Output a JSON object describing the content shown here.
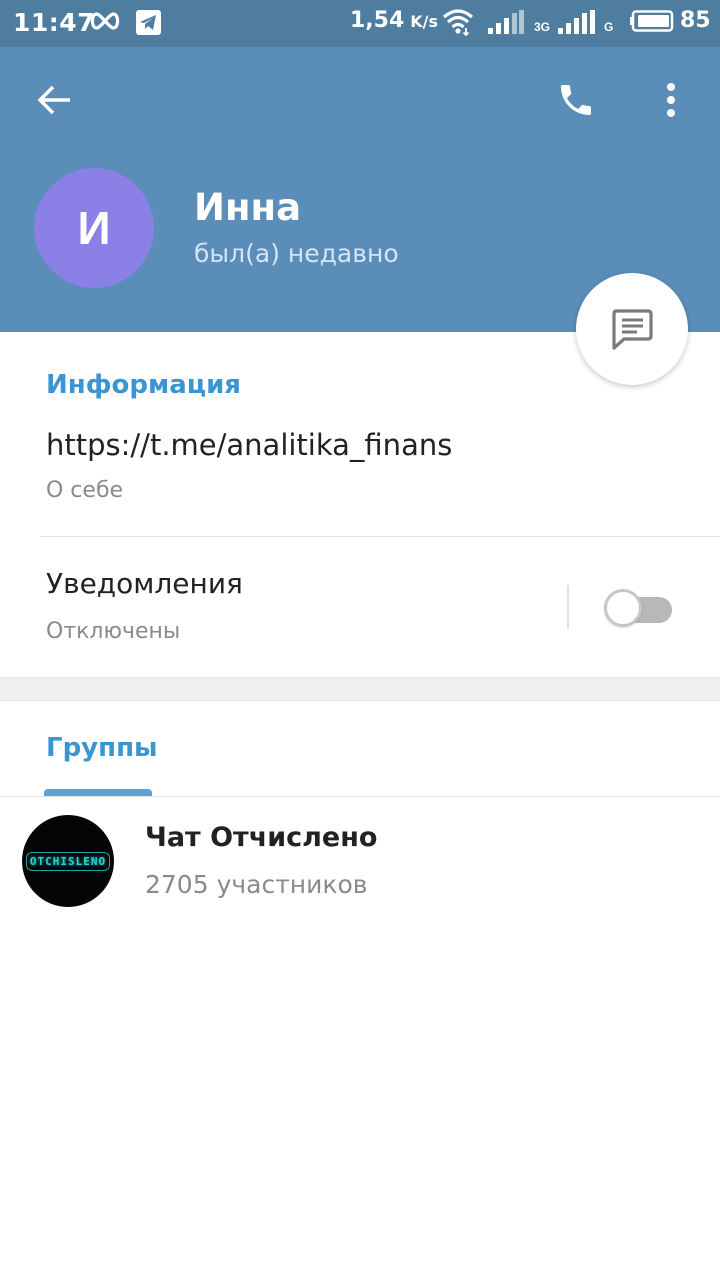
{
  "status_bar": {
    "time": "11:47",
    "speed": "1,54",
    "speed_unit": "K/s",
    "network_1": "3G",
    "network_2": "G",
    "battery": "85",
    "icons": [
      "infinity-icon",
      "telegram-icon",
      "wifi-icon",
      "signal-icon",
      "signal-icon",
      "battery-icon"
    ]
  },
  "header": {
    "back_icon": "arrow-left-icon",
    "call_icon": "phone-icon",
    "more_icon": "more-vert-icon",
    "avatar_letter": "И",
    "avatar_color": "#8a80e6",
    "name": "Инна",
    "last_seen": "был(а) недавно",
    "background": "#5a8db8"
  },
  "fab": {
    "icon": "message-icon"
  },
  "info": {
    "section_title": "Информация",
    "bio": "https://t.me/analitika_finans",
    "bio_caption": "О себе",
    "notifications_title": "Уведомления",
    "notifications_status": "Отключены",
    "notifications_enabled": false
  },
  "groups": {
    "section_title": "Группы",
    "items": [
      {
        "name": "Чат Отчислено",
        "members": "2705 участников",
        "avatar_text": "OTCHISLENO"
      }
    ]
  },
  "colors": {
    "accent": "#3b95d3",
    "status_bar": "#4f7d9f"
  }
}
